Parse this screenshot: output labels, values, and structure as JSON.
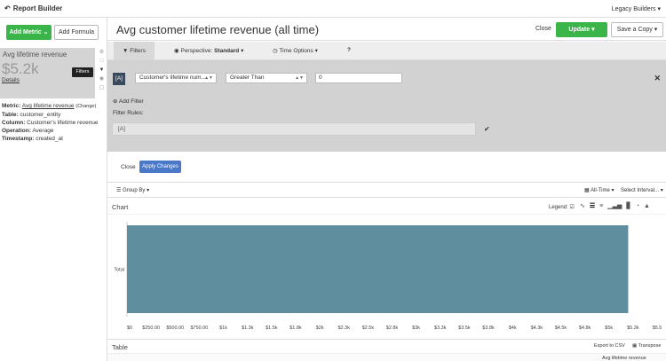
{
  "topbar": {
    "back_label": "Report Builder",
    "account_label": "Legacy Builders"
  },
  "sidebar": {
    "add_metric_label": "Add Metric",
    "add_formula_label": "Add Formula",
    "metric_card": {
      "name": "Avg lifetime revenue",
      "value": "$5.2k",
      "details_label": "Details",
      "tooltip": "Filters"
    },
    "meta": {
      "metric_key": "Metric:",
      "metric_value": "Avg lifetime revenue",
      "change_label": "(Change)",
      "table_key": "Table:",
      "table_value": "customer_entity",
      "column_key": "Column:",
      "column_value": "Customer's lifetime revenue",
      "operation_key": "Operation:",
      "operation_value": "Average",
      "timestamp_key": "Timestamp:",
      "timestamp_value": "created_at"
    }
  },
  "header": {
    "title": "Avg customer lifetime revenue (all time)",
    "close_label": "Close",
    "update_label": "Update",
    "save_copy_label": "Save a Copy"
  },
  "tabs": {
    "filters_label": "Filters",
    "perspective_key": "Perspective:",
    "perspective_value": "Standard",
    "time_options_label": "Time Options",
    "help_label": "?"
  },
  "filter": {
    "tag": "[A]",
    "field_select": "Customer's lifetime num...",
    "operator_select": "Greater Than",
    "value": "0",
    "add_filter_label": "Add Filter",
    "rules_label": "Filter Rules:",
    "rules_value": "[A]",
    "close_label": "Close",
    "apply_label": "Apply Changes"
  },
  "chart_toolbar": {
    "group_by_label": "Group By",
    "time_range_label": "All-Time",
    "interval_label": "Select Interval..."
  },
  "chart_header": {
    "title": "Chart",
    "legend_label": "Legend:"
  },
  "table_header": {
    "title": "Table",
    "export_label": "Export to CSV",
    "transpose_label": "Transpose",
    "column_label": "Avg lifetime revenue"
  },
  "chart_data": {
    "type": "bar",
    "orientation": "horizontal",
    "categories": [
      "Total"
    ],
    "values": [
      5200
    ],
    "xlim": [
      0,
      5500
    ],
    "xticks": [
      "$0",
      "$250.00",
      "$500.00",
      "$750.00",
      "$1k",
      "$1.3k",
      "$1.5k",
      "$1.8k",
      "$2k",
      "$2.3k",
      "$2.5k",
      "$2.8k",
      "$3k",
      "$3.3k",
      "$3.5k",
      "$3.8k",
      "$4k",
      "$4.3k",
      "$4.5k",
      "$4.8k",
      "$5k",
      "$5.3k",
      "$5.5"
    ],
    "color": "#5f8f9e",
    "grid": false,
    "legend": "none"
  },
  "colors": {
    "green": "#3bb54a",
    "blue": "#4a78c8",
    "tag_dark": "#3a4a5e",
    "bar": "#5f8f9e"
  }
}
